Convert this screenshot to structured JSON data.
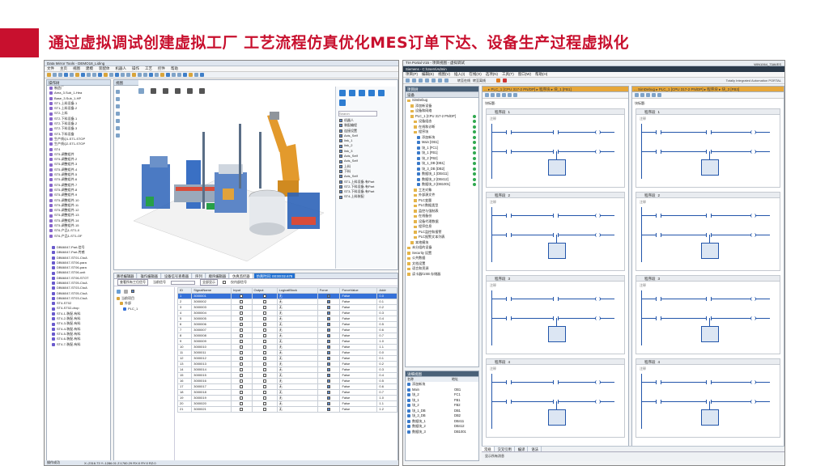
{
  "slide": {
    "title": "通过虚拟调试创建虚拟工厂 工艺流程仿真优化MES订单下达、设备生产过程虚拟化",
    "accent_color": "#c8102e"
  },
  "left_app": {
    "window_title": "Data Mirror Tools - DEMO18_Liding",
    "menu": [
      "文件",
      "主页",
      "视图",
      "建模",
      "装配体",
      "机器人",
      "操作",
      "工艺",
      "控件",
      "帮助"
    ],
    "tree_panel_title": "操作树",
    "tree_items": [
      "制造厂",
      "Area_3.Sub_1-Hea",
      "Base_3.Sub_1-HP",
      "ST1-上料设备-1",
      "ST1-上料设备-2",
      "ST2-上料",
      "ST2-下料设备-1",
      "ST2-下料设备-2",
      "ST2-下料设备-3",
      "ST3-下料设备",
      "生产线Q1-ST1-STOP",
      "生产线Q2-ST1-STOP",
      "ST4",
      "ST5-调整组件",
      "ST5-调整组件-2",
      "ST5-调整组件-3",
      "ST5-调整组件-4",
      "ST5-调整组件-5",
      "ST5-调整组件-6",
      "ST5-调整组件-7",
      "ST5-调整组件-8",
      "ST5-调整组件-9",
      "ST5-调整组件-10",
      "ST5-调整组件-11",
      "ST5-调整组件-12",
      "ST5-调整组件-13",
      "ST5-调整组件-14",
      "ST5-调整组件-15",
      "ST6-产品1-ST1-0",
      "ST6-产品1-ST1-OF"
    ],
    "tree_items_lower": [
      "DB66047-Part-信号",
      "DB66047-Part-传感",
      "DB66047-ST01-CtoA",
      "DB66047-ST06-para",
      "DB66047-ST06-para",
      "DB66047-ST06-unit",
      "DB66047-ST06-STOT",
      "DB66047-ST05-CtoA",
      "DB66047-ST03-CtoA",
      "DB66047-ST05-CtoA",
      "DB66047-ST03-CtoA",
      "ST4-ST02",
      "ST4-ST02-drop",
      "ST4-1-装配-有料",
      "ST4-2-装配-有料",
      "ST4-3-装配-有料",
      "ST4-4-装配-有料",
      "ST4-5-装配-有料",
      "ST4-6-装配-有料",
      "ST4-7-装配-有料"
    ],
    "viewport_tab": "视图",
    "search_placeholder": "Search",
    "side_labels": [
      "机器人",
      "装配编程",
      "连接设置",
      "Axis_Self",
      "link_1",
      "link_2",
      "link_3",
      "Axis_Self",
      "Axis_Self",
      "上料",
      "下料",
      "Axis_Self",
      "ST1-上料设备-有Part",
      "ST2-下料设备-有Part",
      "ST3-下料设备-有Part",
      "ST4-上料装配"
    ],
    "bottom_tabs": [
      "路径编辑器",
      "操作编辑器",
      "设备信号查看器",
      "序列",
      "顺序编辑器",
      "仿真监控器",
      "仿真时间: 00:00:02.678"
    ],
    "signals_toolbar": [
      "查看所有工位信号",
      "当前信号",
      "全部显示",
      "仅内部信号"
    ],
    "signal_tree": [
      "当前项目",
      "外部",
      "PLC_1"
    ],
    "signal_columns": [
      "ID",
      "SignalName",
      "Input",
      "Output",
      "LogicalBlock",
      "Force",
      "ForceValue",
      "Addr"
    ],
    "signal_rows": [
      [
        "1",
        "3000001",
        "无",
        "False",
        "0.0"
      ],
      [
        "2",
        "3000002",
        "无",
        "False",
        "0.1"
      ],
      [
        "3",
        "3000003",
        "无",
        "False",
        "0.2"
      ],
      [
        "4",
        "3000004",
        "无",
        "False",
        "0.3"
      ],
      [
        "5",
        "3000005",
        "无",
        "False",
        "0.4"
      ],
      [
        "6",
        "3000006",
        "无",
        "False",
        "0.5"
      ],
      [
        "7",
        "3000007",
        "无",
        "False",
        "0.6"
      ],
      [
        "8",
        "3000008",
        "无",
        "False",
        "0.7"
      ],
      [
        "9",
        "3000009",
        "无",
        "False",
        "1.0"
      ],
      [
        "10",
        "3000010",
        "无",
        "False",
        "1.1"
      ],
      [
        "11",
        "3000011",
        "无",
        "False",
        "0.0"
      ],
      [
        "12",
        "3000012",
        "无",
        "False",
        "0.1"
      ],
      [
        "13",
        "3000013",
        "无",
        "False",
        "0.2"
      ],
      [
        "14",
        "3000014",
        "无",
        "False",
        "0.3"
      ],
      [
        "15",
        "3000015",
        "无",
        "False",
        "0.4"
      ],
      [
        "16",
        "3000016",
        "无",
        "False",
        "0.5"
      ],
      [
        "17",
        "3000017",
        "无",
        "False",
        "0.6"
      ],
      [
        "18",
        "3000018",
        "无",
        "False",
        "0.7"
      ],
      [
        "19",
        "3000019",
        "无",
        "False",
        "1.0"
      ],
      [
        "20",
        "3000020",
        "无",
        "False",
        "1.1"
      ],
      [
        "21",
        "3000021",
        "无",
        "False",
        "1.2"
      ]
    ],
    "status_bar": "操作成功",
    "status_coords": "X:-2316.73  Y:-1286.01  Z:1760.29  RX:0  RY:0  RZ:0"
  },
  "right_app": {
    "window_title": "TIA Portal V15 - 项目视图 - 虚拟调试",
    "path": "Siemens - C:\\Users\\Admin",
    "menu": [
      "项目(P)",
      "编辑(E)",
      "视图(V)",
      "插入(I)",
      "在线(O)",
      "选项(N)",
      "工具(T)",
      "窗口(W)",
      "帮助(H)"
    ],
    "toolbar_items": [
      "转至在线",
      "转至离线"
    ],
    "brand": "Totally Integrated Automation PORTAL",
    "project_tree_title": "项目树",
    "device_tab": "设备",
    "breadcrumb_left": "... ▸ PLC_1 [CPU 317-2 PN/DP] ▸ 程序块 ▸ 块_1 [FB1]",
    "breadcrumb_right": "... SimDebug ▸ PLC_1 [CPU 317-2 PN/DP] ▸ 程序块 ▸ 块_3 [FB3]",
    "project_tree": [
      "SimDebug",
      "添加新设备",
      "设备和网络",
      "PLC_1 [CPU 317-2 PN/DP]",
      "设备组态",
      "在线和诊断",
      "程序块",
      "添加新块",
      "Main [OB1]",
      "块_1 [FC1]",
      "块_1 [FB1]",
      "块_2 [FB2]",
      "块_1_DB [DB1]",
      "块_3_DB [DB2]",
      "数据块_1 [DB411]",
      "数据块_2 [DB412]",
      "数据块_3 [DB1001]",
      "工艺对象",
      "外部源文件",
      "PLC变量",
      "PLC数据类型",
      "监控与强制表",
      "在线备份",
      "设备代理数据",
      "程序信息",
      "PLC监控和报警",
      "PLC报警文本列表",
      "本地模块",
      "未分组的设备",
      "Security 设置",
      "公共数据",
      "文档设置",
      "语言和资源",
      "读卡器/USB 存储器"
    ],
    "detail_title": "详细视图",
    "detail_columns": [
      "名称",
      "地址"
    ],
    "detail_rows": [
      [
        "添加新块",
        ""
      ],
      [
        "Main",
        "OB1"
      ],
      [
        "块_2",
        "FC1"
      ],
      [
        "块_1",
        "FB1"
      ],
      [
        "块_2",
        "FB2"
      ],
      [
        "块_1_DB",
        "DB1"
      ],
      [
        "块_3_DB",
        "DB2"
      ],
      [
        "数据块_1",
        "DB411"
      ],
      [
        "数据块_2",
        "DB412"
      ],
      [
        "数据块_3",
        "DB1001"
      ]
    ],
    "segment_label": "程序段",
    "segment_numbers": [
      "1",
      "2",
      "3",
      "4"
    ],
    "comment_label": "注释",
    "block_title_label": "块标题:",
    "bottom_tabs": [
      "常规",
      "交叉引用",
      "编译",
      "语法"
    ],
    "bottom_info": "显示所有消息",
    "status_right": "WIN1064_73AVES"
  }
}
